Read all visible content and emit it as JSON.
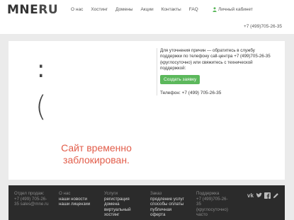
{
  "header": {
    "logo_main": "MNE",
    "logo_ru": "RU",
    "nav": [
      "О нас",
      "Хостинг",
      "Домены",
      "Акции",
      "Контакты",
      "FAQ"
    ],
    "cabinet": "Личный кабинет",
    "phone": "+7 (499)705-26-35"
  },
  "main": {
    "sad_colon": ":",
    "sad_paren": "(",
    "blocked_line1": "Сайт временно",
    "blocked_line2": "заблокирован.",
    "info_text": "Для уточнения причин — обратитесь в службу поддержки по телефону call-центра +7 (499)705-26-35 (круглосуточно) или свяжитесь с технической поддержкой:",
    "create_button": "Создать заявку",
    "phone": "Телефон: +7 (499) 705-26-35"
  },
  "footer": {
    "col1": {
      "head": "Отдел продаж:",
      "line1": "+7 (499) 705-26-",
      "line2": "35 sales@mne.ru"
    },
    "col2": {
      "head": "О нас",
      "line1": "наши новости",
      "line2": "наши лицензии"
    },
    "col3": {
      "head": "Услуги",
      "line1": "регистрация",
      "line2": "домена",
      "line3": "виртуальный",
      "line4": "хостинг"
    },
    "col4": {
      "head": "Заказ",
      "line1": "продление услуг",
      "line2": "способы оплаты",
      "line3": "публичная",
      "line4": "оферта"
    },
    "col5": {
      "head": "Поддержка",
      "line1": "+7 (499)705-26-",
      "line2": "35",
      "line3": "(круглосуточно)",
      "line4": "часто"
    },
    "social": [
      "vk-icon",
      "twitter-icon",
      "facebook-icon",
      "edit-icon"
    ]
  }
}
